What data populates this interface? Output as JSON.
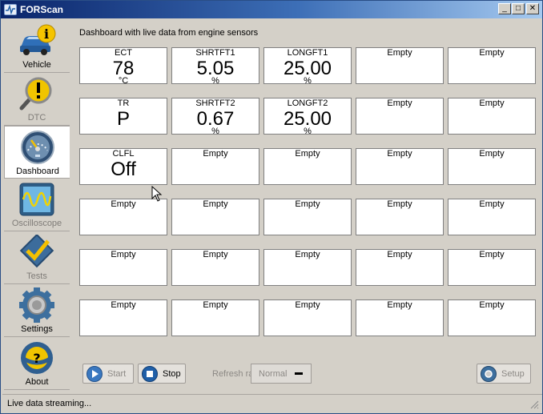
{
  "window": {
    "title": "FORScan"
  },
  "sidebar": {
    "items": [
      {
        "label": "Vehicle",
        "icon": "car-info-icon",
        "state": "normal"
      },
      {
        "label": "DTC",
        "icon": "magnifier-alert-icon",
        "state": "disabled"
      },
      {
        "label": "Dashboard",
        "icon": "gauge-icon",
        "state": "active"
      },
      {
        "label": "Oscilloscope",
        "icon": "oscilloscope-icon",
        "state": "disabled"
      },
      {
        "label": "Tests",
        "icon": "checkmark-icon",
        "state": "disabled"
      },
      {
        "label": "Settings",
        "icon": "gear-icon",
        "state": "normal"
      },
      {
        "label": "About",
        "icon": "steering-wheel-icon",
        "state": "normal"
      }
    ]
  },
  "dashboard": {
    "caption": "Dashboard with live data from engine sensors",
    "cells": [
      {
        "label": "ECT",
        "value": "78",
        "unit": "°C"
      },
      {
        "label": "SHRTFT1",
        "value": "5.05",
        "unit": "%"
      },
      {
        "label": "LONGFT1",
        "value": "25.00",
        "unit": "%"
      },
      {
        "label": "Empty",
        "value": "",
        "unit": ""
      },
      {
        "label": "Empty",
        "value": "",
        "unit": ""
      },
      {
        "label": "TR",
        "value": "P",
        "unit": ""
      },
      {
        "label": "SHRTFT2",
        "value": "0.67",
        "unit": "%"
      },
      {
        "label": "LONGFT2",
        "value": "25.00",
        "unit": "%"
      },
      {
        "label": "Empty",
        "value": "",
        "unit": ""
      },
      {
        "label": "Empty",
        "value": "",
        "unit": ""
      },
      {
        "label": "CLFL",
        "value": "Off",
        "unit": ""
      },
      {
        "label": "Empty",
        "value": "",
        "unit": ""
      },
      {
        "label": "Empty",
        "value": "",
        "unit": ""
      },
      {
        "label": "Empty",
        "value": "",
        "unit": ""
      },
      {
        "label": "Empty",
        "value": "",
        "unit": ""
      },
      {
        "label": "Empty",
        "value": "",
        "unit": ""
      },
      {
        "label": "Empty",
        "value": "",
        "unit": ""
      },
      {
        "label": "Empty",
        "value": "",
        "unit": ""
      },
      {
        "label": "Empty",
        "value": "",
        "unit": ""
      },
      {
        "label": "Empty",
        "value": "",
        "unit": ""
      },
      {
        "label": "Empty",
        "value": "",
        "unit": ""
      },
      {
        "label": "Empty",
        "value": "",
        "unit": ""
      },
      {
        "label": "Empty",
        "value": "",
        "unit": ""
      },
      {
        "label": "Empty",
        "value": "",
        "unit": ""
      },
      {
        "label": "Empty",
        "value": "",
        "unit": ""
      },
      {
        "label": "Empty",
        "value": "",
        "unit": ""
      },
      {
        "label": "Empty",
        "value": "",
        "unit": ""
      },
      {
        "label": "Empty",
        "value": "",
        "unit": ""
      },
      {
        "label": "Empty",
        "value": "",
        "unit": ""
      },
      {
        "label": "Empty",
        "value": "",
        "unit": ""
      }
    ]
  },
  "toolbar": {
    "start_label": "Start",
    "stop_label": "Stop",
    "refresh_label": "Refresh rate:",
    "refresh_value": "Normal",
    "setup_label": "Setup"
  },
  "status": {
    "text": "Live data streaming..."
  },
  "colors": {
    "accent": "#1f5fa8",
    "titlebar": "#0a246a"
  }
}
